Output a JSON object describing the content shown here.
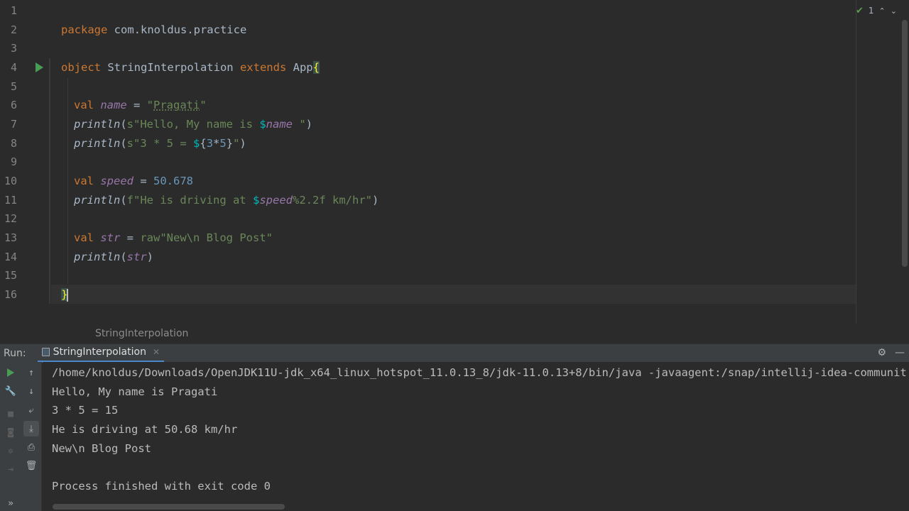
{
  "editor": {
    "line_numbers": [
      "1",
      "2",
      "3",
      "4",
      "5",
      "6",
      "7",
      "8",
      "9",
      "10",
      "11",
      "12",
      "13",
      "14",
      "15",
      "16"
    ],
    "line2": {
      "kw": "package",
      "rest": " com.knoldus.practice"
    },
    "line4": {
      "kw1": "object",
      "name": " StringInterpolation ",
      "kw2": "extends",
      "app": " App",
      "brace": "{"
    },
    "line6": {
      "kw": "val",
      "sp": " ",
      "var": "name",
      "eq": " = ",
      "q1": "\"",
      "strv": "Pragati",
      "q2": "\""
    },
    "line7": {
      "fn": "println",
      "p1": "(",
      "s1": "s\"Hello, My name is ",
      "d": "$",
      "v": "name",
      "s2": " \"",
      "p2": ")"
    },
    "line8": {
      "fn": "println",
      "p1": "(",
      "s1": "s\"3 * 5 = ",
      "d": "$",
      "b1": "{",
      "n1": "3",
      "op": "*",
      "n2": "5",
      "b2": "}",
      "s2": "\"",
      "p2": ")"
    },
    "line10": {
      "kw": "val",
      "sp": " ",
      "var": "speed",
      "eq": " = ",
      "num": "50.678"
    },
    "line11": {
      "fn": "println",
      "p1": "(",
      "s1": "f\"He is driving at ",
      "d": "$",
      "v": "speed",
      "fmt": "%2.2f",
      "s2": " km/hr\"",
      "p2": ")"
    },
    "line13": {
      "kw": "val",
      "sp": " ",
      "var": "str",
      "eq": " = ",
      "raw": "raw",
      "s1": "\"New",
      "esc": "\\n",
      "s2": " Blog Post\""
    },
    "line14": {
      "fn": "println",
      "p1": "(",
      "v": "str",
      "p2": ")"
    },
    "line16": {
      "brace": "}"
    },
    "inspection_count": "1"
  },
  "breadcrumb": {
    "text": "StringInterpolation"
  },
  "run": {
    "label": "Run:",
    "tab_label": "StringInterpolation",
    "console_lines": [
      "/home/knoldus/Downloads/OpenJDK11U-jdk_x64_linux_hotspot_11.0.13_8/jdk-11.0.13+8/bin/java -javaagent:/snap/intellij-idea-communit",
      "Hello, My name is Pragati",
      "3 * 5 = 15",
      "He is driving at 50.68 km/hr",
      "New\\n Blog Post",
      "",
      "Process finished with exit code 0"
    ]
  },
  "icons": {
    "run_gutter": "run-triangle-icon",
    "inspection_ok": "check-icon",
    "settings": "gear-icon",
    "minimize": "minimize-icon"
  },
  "colors": {
    "keyword": "#cc7832",
    "string": "#6a8759",
    "number": "#6897bb",
    "variable": "#9876aa",
    "interpolation": "#00b8bb",
    "run_green": "#499c54"
  }
}
